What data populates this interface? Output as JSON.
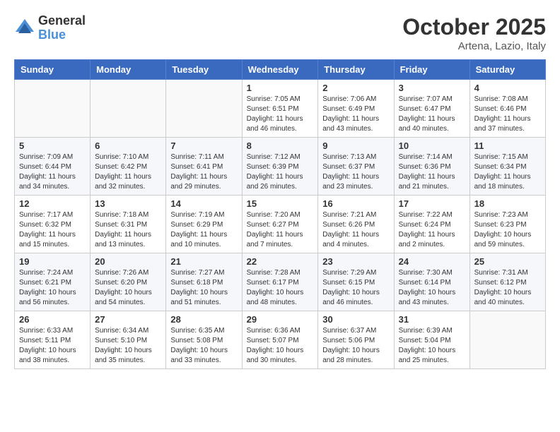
{
  "logo": {
    "general": "General",
    "blue": "Blue"
  },
  "header": {
    "month": "October 2025",
    "location": "Artena, Lazio, Italy"
  },
  "weekdays": [
    "Sunday",
    "Monday",
    "Tuesday",
    "Wednesday",
    "Thursday",
    "Friday",
    "Saturday"
  ],
  "weeks": [
    [
      {
        "day": "",
        "info": ""
      },
      {
        "day": "",
        "info": ""
      },
      {
        "day": "",
        "info": ""
      },
      {
        "day": "1",
        "info": "Sunrise: 7:05 AM\nSunset: 6:51 PM\nDaylight: 11 hours\nand 46 minutes."
      },
      {
        "day": "2",
        "info": "Sunrise: 7:06 AM\nSunset: 6:49 PM\nDaylight: 11 hours\nand 43 minutes."
      },
      {
        "day": "3",
        "info": "Sunrise: 7:07 AM\nSunset: 6:47 PM\nDaylight: 11 hours\nand 40 minutes."
      },
      {
        "day": "4",
        "info": "Sunrise: 7:08 AM\nSunset: 6:46 PM\nDaylight: 11 hours\nand 37 minutes."
      }
    ],
    [
      {
        "day": "5",
        "info": "Sunrise: 7:09 AM\nSunset: 6:44 PM\nDaylight: 11 hours\nand 34 minutes."
      },
      {
        "day": "6",
        "info": "Sunrise: 7:10 AM\nSunset: 6:42 PM\nDaylight: 11 hours\nand 32 minutes."
      },
      {
        "day": "7",
        "info": "Sunrise: 7:11 AM\nSunset: 6:41 PM\nDaylight: 11 hours\nand 29 minutes."
      },
      {
        "day": "8",
        "info": "Sunrise: 7:12 AM\nSunset: 6:39 PM\nDaylight: 11 hours\nand 26 minutes."
      },
      {
        "day": "9",
        "info": "Sunrise: 7:13 AM\nSunset: 6:37 PM\nDaylight: 11 hours\nand 23 minutes."
      },
      {
        "day": "10",
        "info": "Sunrise: 7:14 AM\nSunset: 6:36 PM\nDaylight: 11 hours\nand 21 minutes."
      },
      {
        "day": "11",
        "info": "Sunrise: 7:15 AM\nSunset: 6:34 PM\nDaylight: 11 hours\nand 18 minutes."
      }
    ],
    [
      {
        "day": "12",
        "info": "Sunrise: 7:17 AM\nSunset: 6:32 PM\nDaylight: 11 hours\nand 15 minutes."
      },
      {
        "day": "13",
        "info": "Sunrise: 7:18 AM\nSunset: 6:31 PM\nDaylight: 11 hours\nand 13 minutes."
      },
      {
        "day": "14",
        "info": "Sunrise: 7:19 AM\nSunset: 6:29 PM\nDaylight: 11 hours\nand 10 minutes."
      },
      {
        "day": "15",
        "info": "Sunrise: 7:20 AM\nSunset: 6:27 PM\nDaylight: 11 hours\nand 7 minutes."
      },
      {
        "day": "16",
        "info": "Sunrise: 7:21 AM\nSunset: 6:26 PM\nDaylight: 11 hours\nand 4 minutes."
      },
      {
        "day": "17",
        "info": "Sunrise: 7:22 AM\nSunset: 6:24 PM\nDaylight: 11 hours\nand 2 minutes."
      },
      {
        "day": "18",
        "info": "Sunrise: 7:23 AM\nSunset: 6:23 PM\nDaylight: 10 hours\nand 59 minutes."
      }
    ],
    [
      {
        "day": "19",
        "info": "Sunrise: 7:24 AM\nSunset: 6:21 PM\nDaylight: 10 hours\nand 56 minutes."
      },
      {
        "day": "20",
        "info": "Sunrise: 7:26 AM\nSunset: 6:20 PM\nDaylight: 10 hours\nand 54 minutes."
      },
      {
        "day": "21",
        "info": "Sunrise: 7:27 AM\nSunset: 6:18 PM\nDaylight: 10 hours\nand 51 minutes."
      },
      {
        "day": "22",
        "info": "Sunrise: 7:28 AM\nSunset: 6:17 PM\nDaylight: 10 hours\nand 48 minutes."
      },
      {
        "day": "23",
        "info": "Sunrise: 7:29 AM\nSunset: 6:15 PM\nDaylight: 10 hours\nand 46 minutes."
      },
      {
        "day": "24",
        "info": "Sunrise: 7:30 AM\nSunset: 6:14 PM\nDaylight: 10 hours\nand 43 minutes."
      },
      {
        "day": "25",
        "info": "Sunrise: 7:31 AM\nSunset: 6:12 PM\nDaylight: 10 hours\nand 40 minutes."
      }
    ],
    [
      {
        "day": "26",
        "info": "Sunrise: 6:33 AM\nSunset: 5:11 PM\nDaylight: 10 hours\nand 38 minutes."
      },
      {
        "day": "27",
        "info": "Sunrise: 6:34 AM\nSunset: 5:10 PM\nDaylight: 10 hours\nand 35 minutes."
      },
      {
        "day": "28",
        "info": "Sunrise: 6:35 AM\nSunset: 5:08 PM\nDaylight: 10 hours\nand 33 minutes."
      },
      {
        "day": "29",
        "info": "Sunrise: 6:36 AM\nSunset: 5:07 PM\nDaylight: 10 hours\nand 30 minutes."
      },
      {
        "day": "30",
        "info": "Sunrise: 6:37 AM\nSunset: 5:06 PM\nDaylight: 10 hours\nand 28 minutes."
      },
      {
        "day": "31",
        "info": "Sunrise: 6:39 AM\nSunset: 5:04 PM\nDaylight: 10 hours\nand 25 minutes."
      },
      {
        "day": "",
        "info": ""
      }
    ]
  ]
}
